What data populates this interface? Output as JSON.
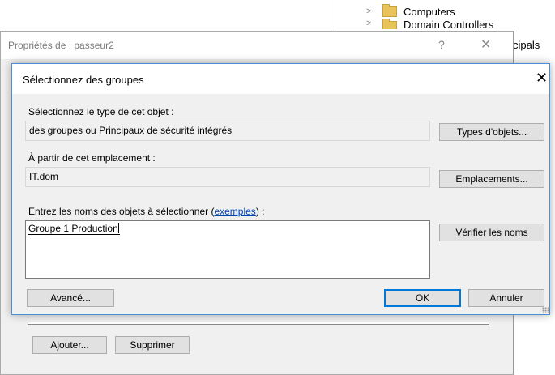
{
  "tree": {
    "items": [
      {
        "label": "Computers"
      },
      {
        "label": "Domain Controllers"
      }
    ],
    "right_partial_text": "cipals"
  },
  "back_window": {
    "title": "Propriétés de : passeur2",
    "help_glyph": "?",
    "close_glyph": "✕",
    "add_button": "Ajouter...",
    "remove_button": "Supprimer"
  },
  "dialog": {
    "title": "Sélectionnez des groupes",
    "close_glyph": "✕",
    "object_type_label": "Sélectionnez le type de cet objet :",
    "object_type_value": "des groupes ou Principaux de sécurité intégrés",
    "object_types_button": "Types d'objets...",
    "location_label": "À partir de cet emplacement :",
    "location_value": "IT.dom",
    "locations_button": "Emplacements...",
    "names_label_prefix": "Entrez les noms des objets à sélectionner (",
    "names_label_link": "exemples",
    "names_label_suffix": ") :",
    "names_value": "Groupe 1 Production",
    "check_names_button": "Vérifier les noms",
    "advanced_button": "Avancé...",
    "ok_button": "OK",
    "cancel_button": "Annuler"
  }
}
